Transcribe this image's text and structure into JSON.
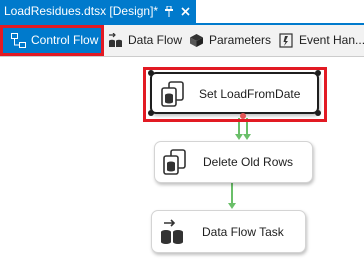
{
  "document_tab": {
    "title": "LoadResidues.dtsx [Design]*",
    "pin_icon": "pin-icon",
    "close_icon": "close-icon"
  },
  "designer_tabs": [
    {
      "label": "Control Flow",
      "icon": "control-flow-icon",
      "active": true
    },
    {
      "label": "Data Flow",
      "icon": "data-flow-icon",
      "active": false
    },
    {
      "label": "Parameters",
      "icon": "parameters-icon",
      "active": false
    },
    {
      "label": "Event Han...",
      "icon": "event-handlers-icon",
      "active": false
    }
  ],
  "tasks": [
    {
      "label": "Set LoadFromDate",
      "icon": "execute-sql-task-icon",
      "selected": true
    },
    {
      "label": "Delete Old Rows",
      "icon": "execute-sql-task-icon",
      "selected": false
    },
    {
      "label": "Data Flow Task",
      "icon": "data-flow-task-icon",
      "selected": false
    }
  ],
  "colors": {
    "accent": "#007acc",
    "highlight": "#e21a23",
    "precedence_success": "#6abf69"
  }
}
